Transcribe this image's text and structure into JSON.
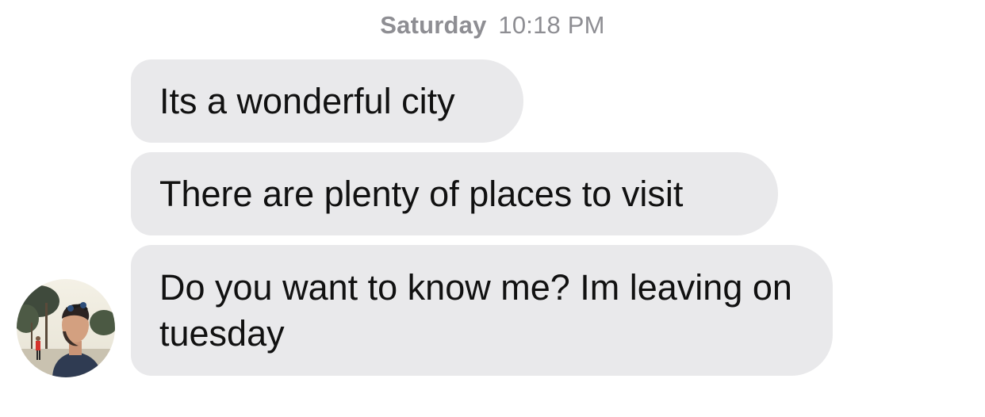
{
  "header": {
    "day": "Saturday",
    "time": "10:18 PM"
  },
  "messages": [
    {
      "text": "Its a wonderful city"
    },
    {
      "text": "There are plenty of places to visit"
    },
    {
      "text": "Do you want to know me? Im leaving on tuesday"
    }
  ],
  "colors": {
    "bubble": "#e9e9eb",
    "timestamp": "#8e8e93",
    "text": "#111111"
  },
  "icons": {
    "avatar": "user-avatar-photo"
  }
}
